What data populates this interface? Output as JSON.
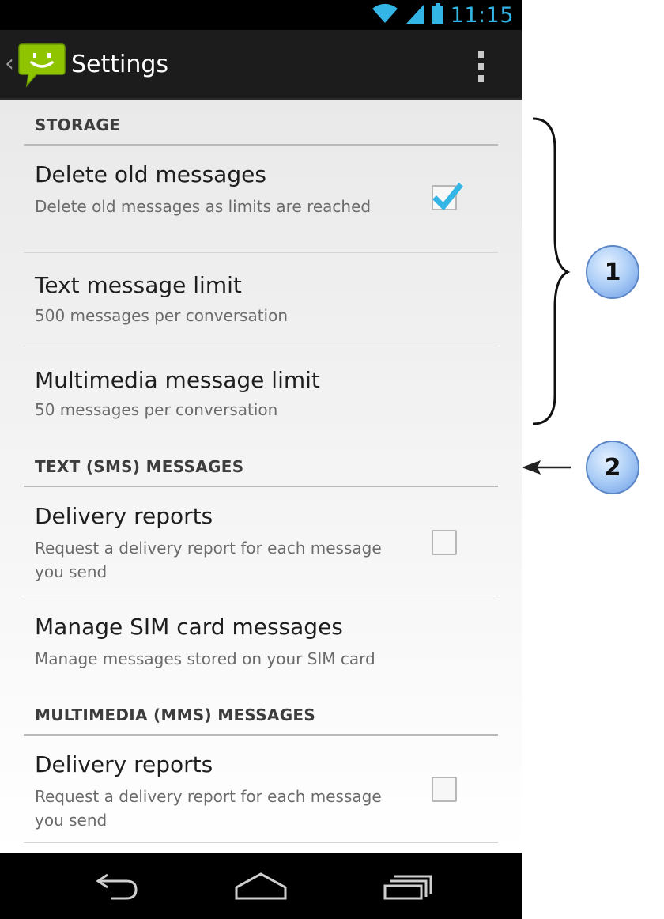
{
  "status_bar": {
    "time": "11:15",
    "icons": [
      "wifi-icon",
      "signal-icon",
      "battery-icon"
    ]
  },
  "action_bar": {
    "title": "Settings",
    "app_icon": "messaging-smiley-icon",
    "overflow_icon": "overflow-menu-icon"
  },
  "sections": {
    "storage": {
      "header": "STORAGE",
      "items": {
        "delete_old": {
          "title": "Delete old messages",
          "summary": "Delete old messages as limits are reached",
          "checked": true
        },
        "text_limit": {
          "title": "Text message limit",
          "summary": "500 messages per conversation"
        },
        "mms_limit": {
          "title": "Multimedia message limit",
          "summary": "50 messages per conversation"
        }
      }
    },
    "sms": {
      "header": "TEXT (SMS) MESSAGES",
      "items": {
        "delivery": {
          "title": "Delivery reports",
          "summary": "Request a delivery report for each message you send",
          "checked": false
        },
        "sim": {
          "title": "Manage SIM card messages",
          "summary": "Manage messages stored on your SIM card"
        }
      }
    },
    "mms": {
      "header": "MULTIMEDIA (MMS) MESSAGES",
      "items": {
        "delivery": {
          "title": "Delivery reports",
          "summary": "Request a delivery report for each message you send",
          "checked": false
        }
      }
    }
  },
  "nav_bar": {
    "icons": [
      "back-icon",
      "home-icon",
      "recent-apps-icon"
    ]
  },
  "callouts": {
    "one": "1",
    "two": "2"
  },
  "colors": {
    "accent": "#33b5e5",
    "check": "#33b5e5",
    "callout_fill": "#a9ccf6"
  }
}
